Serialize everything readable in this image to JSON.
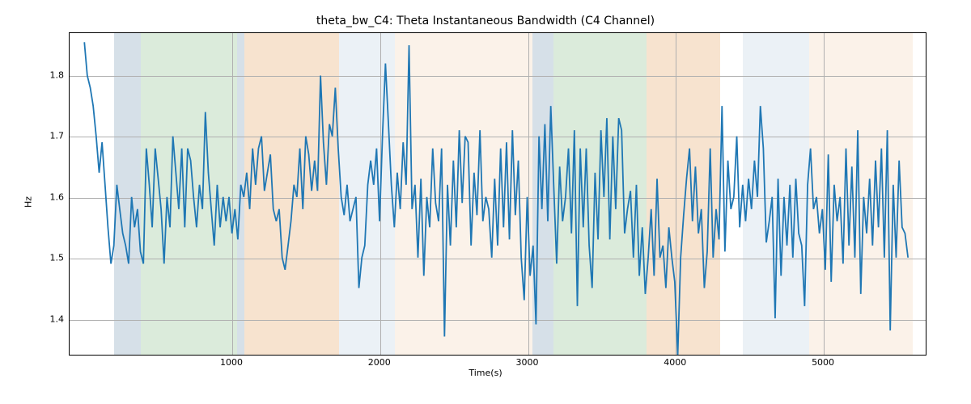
{
  "chart_data": {
    "type": "line",
    "title": "theta_bw_C4: Theta Instantaneous Bandwidth (C4 Channel)",
    "xlabel": "Time(s)",
    "ylabel": "Hz",
    "xlim": [
      -100,
      5700
    ],
    "ylim": [
      1.34,
      1.87
    ],
    "xticks": [
      1000,
      2000,
      3000,
      4000,
      5000
    ],
    "yticks": [
      1.4,
      1.5,
      1.6,
      1.7,
      1.8
    ],
    "line_color": "#1f77b4",
    "bg_regions": [
      {
        "start": 200,
        "end": 380,
        "color": "#6b8ead"
      },
      {
        "start": 380,
        "end": 1030,
        "color": "#7cb87c"
      },
      {
        "start": 1030,
        "end": 1080,
        "color": "#6b8ead"
      },
      {
        "start": 1080,
        "end": 1720,
        "color": "#e39a52"
      },
      {
        "start": 1720,
        "end": 2100,
        "color": "#b8cbe0"
      },
      {
        "start": 2100,
        "end": 3030,
        "color": "#f2d2b0"
      },
      {
        "start": 3030,
        "end": 3170,
        "color": "#6b8ead"
      },
      {
        "start": 3170,
        "end": 3800,
        "color": "#7cb87c"
      },
      {
        "start": 3800,
        "end": 4300,
        "color": "#e39a52"
      },
      {
        "start": 4450,
        "end": 4900,
        "color": "#b8cbe0"
      },
      {
        "start": 4900,
        "end": 5600,
        "color": "#f2d2b0"
      }
    ],
    "x": [
      0,
      20,
      40,
      60,
      80,
      100,
      120,
      140,
      160,
      180,
      200,
      220,
      240,
      260,
      280,
      300,
      320,
      340,
      360,
      380,
      400,
      420,
      440,
      460,
      480,
      500,
      520,
      540,
      560,
      580,
      600,
      620,
      640,
      660,
      680,
      700,
      720,
      740,
      760,
      780,
      800,
      820,
      840,
      860,
      880,
      900,
      920,
      940,
      960,
      980,
      1000,
      1020,
      1040,
      1060,
      1080,
      1100,
      1120,
      1140,
      1160,
      1180,
      1200,
      1220,
      1240,
      1260,
      1280,
      1300,
      1320,
      1340,
      1360,
      1380,
      1400,
      1420,
      1440,
      1460,
      1480,
      1500,
      1520,
      1540,
      1560,
      1580,
      1600,
      1620,
      1640,
      1660,
      1680,
      1700,
      1720,
      1740,
      1760,
      1780,
      1800,
      1820,
      1840,
      1860,
      1880,
      1900,
      1920,
      1940,
      1960,
      1980,
      2000,
      2020,
      2040,
      2060,
      2080,
      2100,
      2120,
      2140,
      2160,
      2180,
      2200,
      2220,
      2240,
      2260,
      2280,
      2300,
      2320,
      2340,
      2360,
      2380,
      2400,
      2420,
      2440,
      2460,
      2480,
      2500,
      2520,
      2540,
      2560,
      2580,
      2600,
      2620,
      2640,
      2660,
      2680,
      2700,
      2720,
      2740,
      2760,
      2780,
      2800,
      2820,
      2840,
      2860,
      2880,
      2900,
      2920,
      2940,
      2960,
      2980,
      3000,
      3020,
      3040,
      3060,
      3080,
      3100,
      3120,
      3140,
      3160,
      3180,
      3200,
      3220,
      3240,
      3260,
      3280,
      3300,
      3320,
      3340,
      3360,
      3380,
      3400,
      3420,
      3440,
      3460,
      3480,
      3500,
      3520,
      3540,
      3560,
      3580,
      3600,
      3620,
      3640,
      3660,
      3680,
      3700,
      3720,
      3740,
      3760,
      3780,
      3800,
      3820,
      3840,
      3860,
      3880,
      3900,
      3920,
      3940,
      3960,
      3980,
      4000,
      4020,
      4040,
      4060,
      4080,
      4100,
      4120,
      4140,
      4160,
      4180,
      4200,
      4220,
      4240,
      4260,
      4280,
      4300,
      4320,
      4340,
      4360,
      4380,
      4400,
      4420,
      4440,
      4460,
      4480,
      4500,
      4520,
      4540,
      4560,
      4580,
      4600,
      4620,
      4640,
      4660,
      4680,
      4700,
      4720,
      4740,
      4760,
      4780,
      4800,
      4820,
      4840,
      4860,
      4880,
      4900,
      4920,
      4940,
      4960,
      4980,
      5000,
      5020,
      5040,
      5060,
      5080,
      5100,
      5120,
      5140,
      5160,
      5180,
      5200,
      5220,
      5240,
      5260,
      5280,
      5300,
      5320,
      5340,
      5360,
      5380,
      5400,
      5420,
      5440,
      5460,
      5480,
      5500,
      5520,
      5540,
      5560,
      5580
    ],
    "y": [
      1.855,
      1.8,
      1.78,
      1.75,
      1.7,
      1.64,
      1.69,
      1.62,
      1.55,
      1.49,
      1.52,
      1.62,
      1.58,
      1.54,
      1.52,
      1.49,
      1.6,
      1.55,
      1.58,
      1.51,
      1.49,
      1.68,
      1.62,
      1.55,
      1.68,
      1.63,
      1.58,
      1.49,
      1.6,
      1.55,
      1.7,
      1.64,
      1.58,
      1.68,
      1.55,
      1.68,
      1.66,
      1.6,
      1.55,
      1.62,
      1.58,
      1.74,
      1.64,
      1.58,
      1.52,
      1.62,
      1.55,
      1.6,
      1.56,
      1.6,
      1.54,
      1.58,
      1.53,
      1.62,
      1.6,
      1.64,
      1.58,
      1.68,
      1.62,
      1.68,
      1.7,
      1.61,
      1.64,
      1.67,
      1.58,
      1.56,
      1.58,
      1.5,
      1.48,
      1.52,
      1.56,
      1.62,
      1.6,
      1.68,
      1.58,
      1.7,
      1.67,
      1.61,
      1.66,
      1.61,
      1.8,
      1.69,
      1.62,
      1.72,
      1.7,
      1.78,
      1.68,
      1.6,
      1.57,
      1.62,
      1.56,
      1.58,
      1.6,
      1.45,
      1.5,
      1.52,
      1.62,
      1.66,
      1.62,
      1.68,
      1.56,
      1.7,
      1.82,
      1.72,
      1.62,
      1.55,
      1.64,
      1.58,
      1.69,
      1.62,
      1.85,
      1.58,
      1.62,
      1.5,
      1.63,
      1.47,
      1.6,
      1.55,
      1.68,
      1.59,
      1.56,
      1.68,
      1.37,
      1.62,
      1.52,
      1.66,
      1.55,
      1.71,
      1.59,
      1.7,
      1.69,
      1.52,
      1.64,
      1.57,
      1.71,
      1.56,
      1.6,
      1.58,
      1.5,
      1.63,
      1.52,
      1.68,
      1.55,
      1.69,
      1.53,
      1.71,
      1.57,
      1.66,
      1.5,
      1.43,
      1.6,
      1.47,
      1.52,
      1.39,
      1.7,
      1.58,
      1.72,
      1.56,
      1.75,
      1.62,
      1.49,
      1.65,
      1.56,
      1.6,
      1.68,
      1.54,
      1.71,
      1.42,
      1.68,
      1.55,
      1.68,
      1.52,
      1.45,
      1.64,
      1.53,
      1.71,
      1.6,
      1.73,
      1.53,
      1.7,
      1.58,
      1.73,
      1.71,
      1.54,
      1.58,
      1.61,
      1.5,
      1.62,
      1.47,
      1.55,
      1.44,
      1.5,
      1.58,
      1.47,
      1.63,
      1.5,
      1.52,
      1.45,
      1.55,
      1.5,
      1.46,
      1.34,
      1.5,
      1.57,
      1.63,
      1.68,
      1.56,
      1.65,
      1.54,
      1.58,
      1.45,
      1.51,
      1.68,
      1.5,
      1.58,
      1.53,
      1.75,
      1.51,
      1.66,
      1.58,
      1.6,
      1.7,
      1.55,
      1.62,
      1.56,
      1.63,
      1.58,
      1.66,
      1.6,
      1.75,
      1.68,
      1.525,
      1.56,
      1.6,
      1.4,
      1.63,
      1.47,
      1.6,
      1.52,
      1.62,
      1.5,
      1.63,
      1.54,
      1.52,
      1.42,
      1.62,
      1.68,
      1.58,
      1.6,
      1.54,
      1.58,
      1.48,
      1.67,
      1.46,
      1.62,
      1.56,
      1.6,
      1.49,
      1.68,
      1.52,
      1.65,
      1.5,
      1.71,
      1.44,
      1.6,
      1.54,
      1.63,
      1.52,
      1.66,
      1.55,
      1.68,
      1.5,
      1.71,
      1.38,
      1.62,
      1.5,
      1.66,
      1.55,
      1.54,
      1.5
    ]
  }
}
